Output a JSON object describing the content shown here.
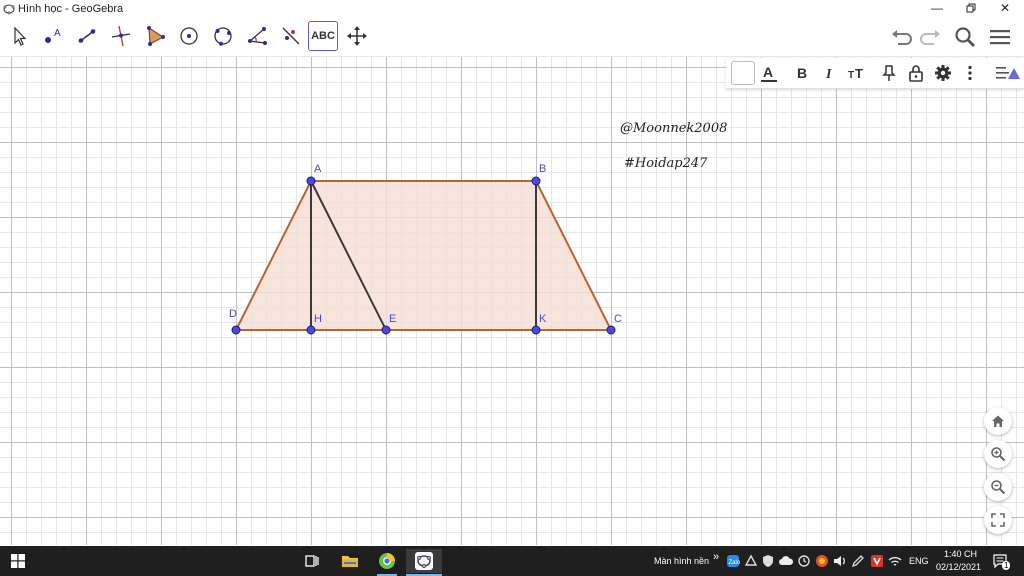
{
  "window": {
    "title": "Hình học - GeoGebra"
  },
  "toolbar": {
    "abc_label": "ABC",
    "tools": [
      "move",
      "point",
      "line",
      "perpendicular-line",
      "polygon",
      "circle-center",
      "circle-three-points",
      "angle",
      "reflect",
      "text",
      "move-graphics-view"
    ]
  },
  "canvas": {
    "credit": "@Moonnek2008",
    "hashtag": "#Hoidap247",
    "points": [
      "A",
      "B",
      "C",
      "D",
      "H",
      "E",
      "K"
    ],
    "fill_color": "#f5ded5",
    "stroke_color": "#b5652f",
    "point_color": "#4a4ae0"
  },
  "taskbar": {
    "desktop_label": "Màn hình nền",
    "language": "ENG",
    "time": "1:40 CH",
    "date": "02/12/2021",
    "notification_count": "1"
  }
}
